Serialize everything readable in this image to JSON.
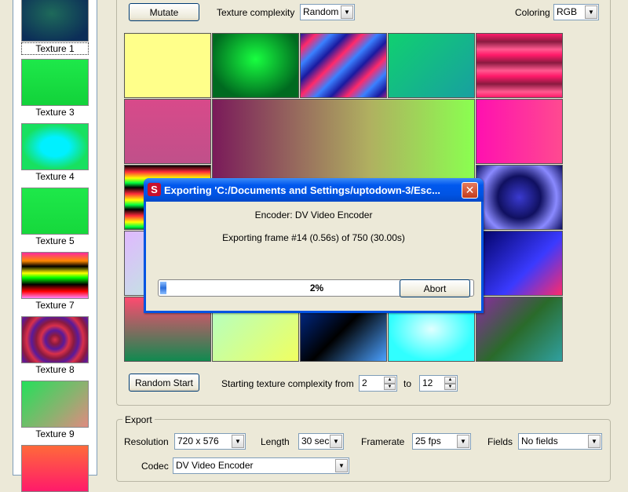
{
  "sidebar": {
    "items": [
      {
        "label": "Texture 1",
        "selected": true,
        "bg": "radial-gradient(ellipse at 45% 40%, #1e6a5a, #0c2e58 80%)"
      },
      {
        "label": "Texture 3",
        "selected": false,
        "bg": "linear-gradient(#1ee84a, #12d23a)"
      },
      {
        "label": "Texture 4",
        "selected": false,
        "bg": "radial-gradient(ellipse at 50% 50%, #00f0ff 0%, #00f0ff 30%, #18e060 70%)"
      },
      {
        "label": "Texture 5",
        "selected": false,
        "bg": "linear-gradient(#1ee84a, #16d83c)"
      },
      {
        "label": "Texture 7",
        "selected": false,
        "bg": "linear-gradient(#ff2a9c 0%, #ff8800 18%, #000 30%, #ffff00 45%, #00ff00 55%, #000 70%, #ff0000 85%, #ff88ff 100%)"
      },
      {
        "label": "Texture 8",
        "selected": false,
        "bg": "repeating-radial-gradient(circle at 50% 50%, #d8304a 0px, #8a1a40 6px, #5a1a9a 12px, #d8304a 18px)"
      },
      {
        "label": "Texture 9",
        "selected": false,
        "bg": "linear-gradient(135deg, #24e05a, #8fb070 60%, #e08a80)"
      },
      {
        "label": "",
        "selected": false,
        "bg": "linear-gradient(#ff6a3a, #ff1a6a)"
      }
    ]
  },
  "main": {
    "mutate_label": "Mutate",
    "complexity_label": "Texture complexity",
    "complexity_value": "Random",
    "coloring_label": "Coloring",
    "coloring_value": "RGB",
    "random_start_label": "Random Start",
    "start_complexity_label": "Starting texture complexity from",
    "from_value": "2",
    "to_label": "to",
    "to_value": "12",
    "tiles": [
      "linear-gradient(#ffff8a, #ffff8a)",
      "radial-gradient(ellipse at 50% 40%, #18ff40, #006a20 75%)",
      "repeating-linear-gradient(135deg, #1a1aa0 0px, #ff2a6a 14px, #3a80ff 28px, #1a1aa0 42px)",
      "linear-gradient(135deg, #10d070, #18a0a0)",
      "repeating-linear-gradient(180deg, #ff1a6a 0px, #8a1a40 10px, #ff5a90 20px, #ff1a6a 27px)",
      "linear-gradient(#d84a8a, #c0508a)",
      "linear-gradient(90deg, #ff10b0, #ff4a90)",
      "repeating-linear-gradient(180deg, #000 0px, #ff2a3a 8px, #ffff00 16px, #00ff40 22px, #000 28px)",
      "radial-gradient(circle at 50% 50%, #3a3ad0, #101060 40%, #8a8aff 70%, #101060)",
      "linear-gradient(135deg, #e0b8ff, #b0ffd0)",
      "linear-gradient(135deg, #000060, #3a3aff 60%, #ff2a6a)",
      "linear-gradient(#ff4a70, #108a50)",
      "linear-gradient(135deg, #b0ffc8, #f0ff60)",
      "linear-gradient(135deg, #0030a0, #000 50%, #4aa0ff)",
      "radial-gradient(ellipse at 50% 50%, #e0ffff, #30ffff 70%)",
      "linear-gradient(135deg, #8a2aa0, #2a6a2a 50%, #30a0a0)"
    ],
    "big_tile": "linear-gradient(90deg, #7a1a5a, #b0b060 60%, #8aff50)"
  },
  "export": {
    "group_label": "Export",
    "resolution_label": "Resolution",
    "resolution_value": "720 x 576",
    "length_label": "Length",
    "length_value": "30 sec",
    "framerate_label": "Framerate",
    "framerate_value": "25 fps",
    "fields_label": "Fields",
    "fields_value": "No fields",
    "codec_label": "Codec",
    "codec_value": "DV Video Encoder"
  },
  "dialog": {
    "title": "Exporting 'C:/Documents and Settings/uptodown-3/Esc...",
    "encoder_text": "Encoder: DV Video Encoder",
    "frame_text": "Exporting frame #14 (0.56s) of 750 (30.00s)",
    "progress_percent": 2,
    "progress_text": "2%",
    "abort_label": "Abort"
  }
}
